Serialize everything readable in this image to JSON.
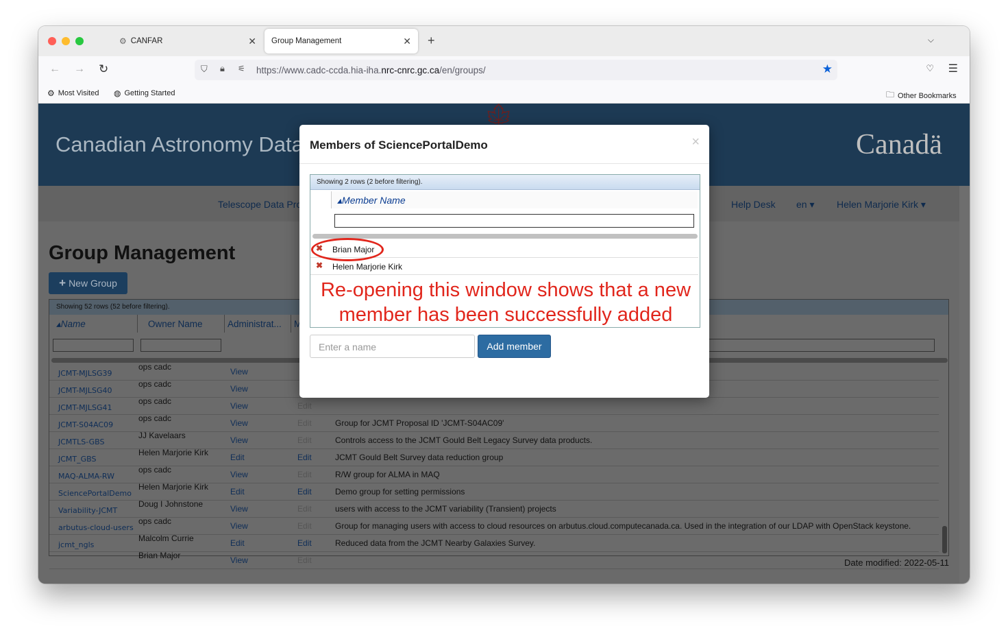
{
  "browser": {
    "tabs": [
      {
        "label": "CANFAR"
      },
      {
        "label": "Group Management"
      }
    ],
    "url_prefix": "https://www.cadc-ccda.hia-iha.",
    "url_domain": "nrc-cnrc.gc.ca",
    "url_path": "/en/groups/",
    "bookmarks": {
      "most_visited": "Most Visited",
      "getting_started": "Getting Started",
      "other": "Other Bookmarks"
    }
  },
  "site": {
    "banner_title": "Canadian Astronomy Data",
    "canada_wordmark": "Canadä",
    "menu": {
      "telescope": "Telescope Data Pro",
      "help": "Help Desk",
      "lang": "en ▾",
      "user": "Helen Marjorie Kirk ▾"
    }
  },
  "page": {
    "title": "Group Management",
    "new_group": "New Group",
    "showing": "Showing 52 rows (52 before filtering).",
    "headers": [
      "▴Name",
      "Owner Name",
      "Administrat...",
      "M"
    ],
    "rows": [
      {
        "name": "JCMT-MJLSG39",
        "owner": "ops cadc",
        "admin": "View",
        "members": "",
        "desc": ""
      },
      {
        "name": "JCMT-MJLSG40",
        "owner": "ops cadc",
        "admin": "View",
        "members": "",
        "desc": ""
      },
      {
        "name": "JCMT-MJLSG41",
        "owner": "ops cadc",
        "admin": "View",
        "members": "Edit",
        "desc": ""
      },
      {
        "name": "JCMT-S04AC09",
        "owner": "ops cadc",
        "admin": "View",
        "members": "Edit",
        "desc": "Group for JCMT Proposal ID 'JCMT-S04AC09'"
      },
      {
        "name": "JCMTLS-GBS",
        "owner": "JJ Kavelaars",
        "admin": "View",
        "members": "Edit",
        "desc": "Controls access to the JCMT Gould Belt Legacy Survey data products."
      },
      {
        "name": "JCMT_GBS",
        "owner": "Helen Marjorie Kirk",
        "admin": "Edit",
        "members": "Edit",
        "desc": "JCMT Gould Belt Survey data reduction group"
      },
      {
        "name": "MAQ-ALMA-RW",
        "owner": "ops cadc",
        "admin": "View",
        "members": "Edit",
        "desc": "R/W group for ALMA in MAQ"
      },
      {
        "name": "SciencePortalDemo",
        "owner": "Helen Marjorie Kirk",
        "admin": "Edit",
        "members": "Edit",
        "desc": "Demo group for setting permissions"
      },
      {
        "name": "Variability-JCMT",
        "owner": "Doug I Johnstone",
        "admin": "View",
        "members": "Edit",
        "desc": "users with access to the JCMT variability (Transient) projects"
      },
      {
        "name": "arbutus-cloud-users",
        "owner": "ops cadc",
        "admin": "View",
        "members": "Edit",
        "desc": "Group for managing users with access to cloud resources on arbutus.cloud.computecanada.ca. Used in the integration of our LDAP with OpenStack keystone."
      },
      {
        "name": "jcmt_ngls",
        "owner": "Malcolm Currie",
        "admin": "Edit",
        "members": "Edit",
        "desc": "Reduced data from the JCMT Nearby Galaxies Survey."
      },
      {
        "name": "",
        "owner": "Brian Major",
        "admin": "View",
        "members": "Edit",
        "desc": ""
      }
    ],
    "date_modified": "Date modified: 2022-05-11"
  },
  "modal": {
    "title": "Members of SciencePortalDemo",
    "close": "×",
    "showing": "Showing 2 rows (2 before filtering).",
    "column": "▴Member Name",
    "members": [
      {
        "name": "Brian Major"
      },
      {
        "name": "Helen Marjorie Kirk"
      }
    ],
    "annotation": "Re-opening this window shows that a new member has been successfully added",
    "input_placeholder": "Enter a name",
    "add_button": "Add member"
  }
}
